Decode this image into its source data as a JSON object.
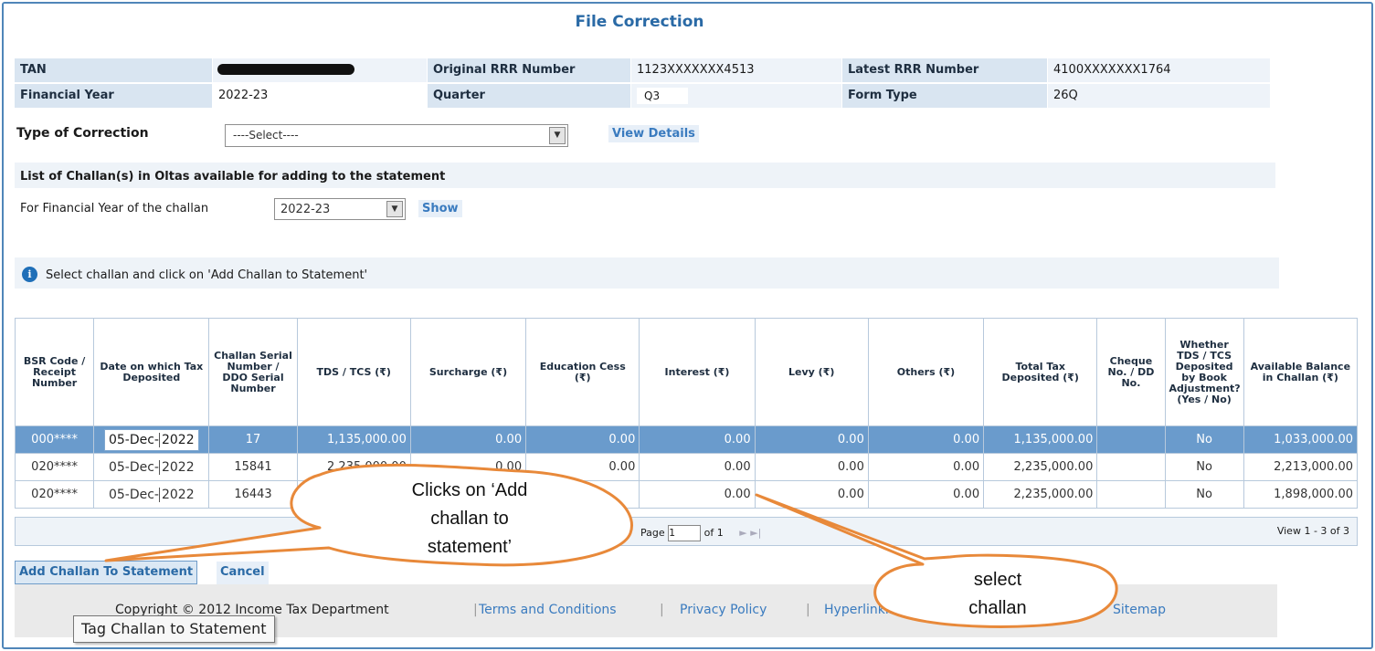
{
  "page": {
    "title": "File Correction"
  },
  "header": {
    "tan_label": "TAN",
    "orig_rrr_label": "Original RRR Number",
    "orig_rrr_value": "1123XXXXXXX4513",
    "latest_rrr_label": "Latest RRR Number",
    "latest_rrr_value": "4100XXXXXXX1764",
    "fy_label": "Financial Year",
    "fy_value": "2022-23",
    "quarter_label": "Quarter",
    "quarter_value": "Q3",
    "form_label": "Form Type",
    "form_value": "26Q"
  },
  "correction": {
    "label": "Type of Correction",
    "selected": "----Select----",
    "view_details": "View Details"
  },
  "challan_list": {
    "title": "List of Challan(s) in Oltas available for adding to the statement",
    "fy_label": "For Financial Year of the challan",
    "fy_selected": "2022-23",
    "show": "Show"
  },
  "info": {
    "text": "Select challan and click on 'Add Challan to Statement'"
  },
  "table": {
    "columns": [
      "BSR Code / Receipt Number",
      "Date on which Tax Deposited",
      "Challan Serial Number / DDO Serial Number",
      "TDS / TCS (₹)",
      "Surcharge (₹)",
      "Education Cess (₹)",
      "Interest (₹)",
      "Levy (₹)",
      "Others (₹)",
      "Total Tax Deposited (₹)",
      "Cheque No. / DD No.",
      "Whether TDS / TCS Deposited by Book Adjustment? (Yes / No)",
      "Available Balance in Challan (₹)"
    ],
    "rows": [
      {
        "bsr": "000****",
        "date_day": "05-Dec-",
        "date_year": "2022",
        "serial": "17",
        "tds": "1,135,000.00",
        "surcharge": "0.00",
        "cess": "0.00",
        "interest": "0.00",
        "levy": "0.00",
        "others": "0.00",
        "total": "1,135,000.00",
        "cheque": "",
        "book": "No",
        "balance": "1,033,000.00"
      },
      {
        "bsr": "020****",
        "date_day": "05-Dec-",
        "date_year": "2022",
        "serial": "15841",
        "tds": "2,235,000.00",
        "surcharge": "0.00",
        "cess": "0.00",
        "interest": "0.00",
        "levy": "0.00",
        "others": "0.00",
        "total": "2,235,000.00",
        "cheque": "",
        "book": "No",
        "balance": "2,213,000.00"
      },
      {
        "bsr": "020****",
        "date_day": "05-Dec-",
        "date_year": "2022",
        "serial": "16443",
        "tds": "",
        "surcharge": "",
        "cess": "",
        "interest": "0.00",
        "levy": "0.00",
        "others": "0.00",
        "total": "2,235,000.00",
        "cheque": "",
        "book": "No",
        "balance": "1,898,000.00"
      }
    ]
  },
  "pager": {
    "page_label": "Page",
    "page_value": "1",
    "of_label": "of 1",
    "view_text": "View 1 - 3 of 3"
  },
  "actions": {
    "add": "Add Challan To Statement",
    "cancel": "Cancel"
  },
  "footer": {
    "copyright": "Copyright © 2012 Income Tax Department",
    "terms": "Terms and Conditions",
    "privacy": "Privacy Policy",
    "hyperlinking": "Hyperlinking",
    "sitemap": "Sitemap"
  },
  "tooltip": "Tag Challan to Statement",
  "callouts": {
    "add_line1": "Clicks on ‘Add",
    "add_line2": "challan to",
    "add_line3": "statement’",
    "select_line1": "select",
    "select_line2": "challan"
  },
  "colors": {
    "accent": "#2a6aa6",
    "selected_row": "#6a9bcc",
    "callout_stroke": "#e8893a"
  }
}
